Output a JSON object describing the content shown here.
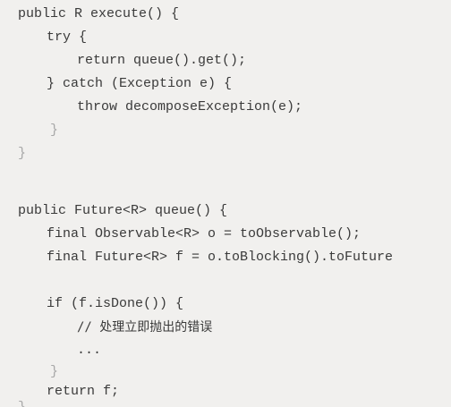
{
  "code": {
    "line_01": "public R execute() {",
    "line_02": "try {",
    "line_03": "return queue().get();",
    "line_04": "} catch (Exception e) {",
    "line_05": "throw decomposeException(e);",
    "line_06": "}",
    "line_07": "}",
    "line_08": "public Future<R> queue() {",
    "line_09": "final Observable<R> o = toObservable();",
    "line_10": "final Future<R> f = o.toBlocking().toFuture",
    "line_11": "if (f.isDone()) {",
    "line_12": "// 处理立即抛出的错误",
    "line_13": "...",
    "line_14": "}",
    "line_15": "return f;",
    "line_16": "}"
  }
}
